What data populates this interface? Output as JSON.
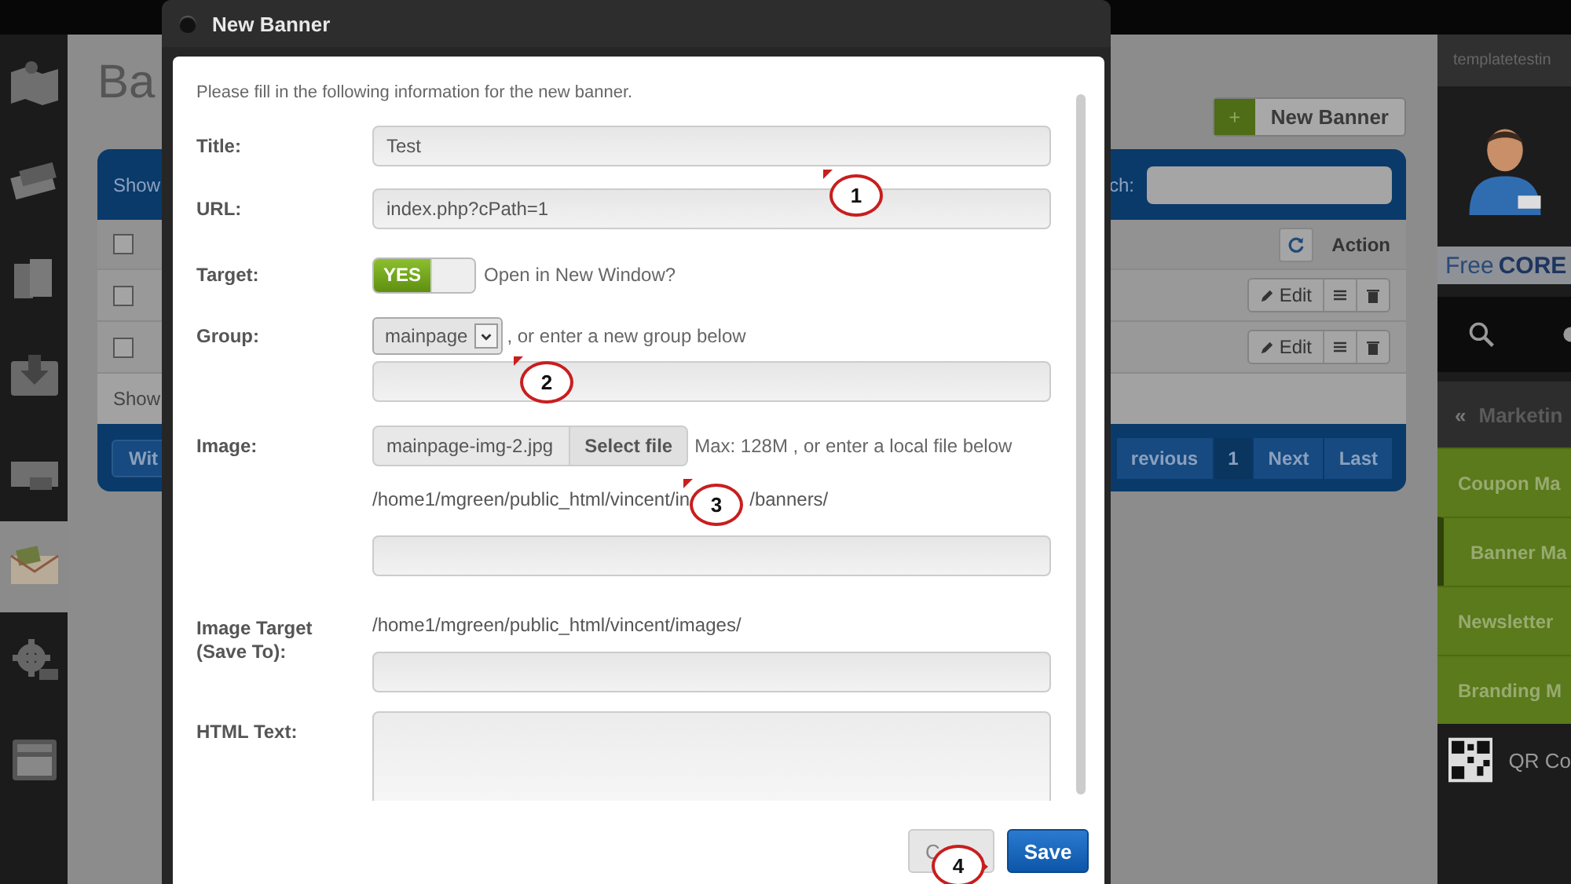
{
  "left_sidebar": {
    "items": [
      {
        "selected": false
      },
      {
        "selected": false
      },
      {
        "selected": false
      },
      {
        "selected": false
      },
      {
        "selected": false
      },
      {
        "selected": true
      },
      {
        "selected": false
      },
      {
        "selected": false
      }
    ]
  },
  "page": {
    "heading": "Ba",
    "new_button": {
      "icon": "+",
      "label": "New Banner"
    }
  },
  "table": {
    "show_label": "Show",
    "search_label": "ch:",
    "header": {
      "checked": false,
      "action_label": "Action"
    },
    "rows": [
      {
        "checked": false,
        "edit": "Edit"
      },
      {
        "checked": false,
        "edit": "Edit"
      }
    ],
    "footer_label": "Show",
    "bottom_button": "Wit",
    "pagination": [
      {
        "label": "revious",
        "selected": false
      },
      {
        "label": "1",
        "selected": true
      },
      {
        "label": "Next",
        "selected": false
      },
      {
        "label": "Last",
        "selected": false
      }
    ]
  },
  "right_sidebar": {
    "user": "templatetestin",
    "promo_plain": "Free",
    "promo_bold": "CORE",
    "menu_icon": "«",
    "menu_title": "Marketin",
    "items": [
      {
        "label": "Coupon Ma",
        "selected": false
      },
      {
        "label": "Banner Ma",
        "selected": true
      },
      {
        "label": "Newsletter",
        "selected": false
      },
      {
        "label": "Branding M",
        "selected": false
      }
    ],
    "qr_item": "QR Co"
  },
  "dialog": {
    "title": "New Banner",
    "intro": "Please fill in the following information for the new banner.",
    "title_label": "Title:",
    "title_value": "Test",
    "url_label": "URL:",
    "url_value": "index.php?cPath=1",
    "target_label": "Target:",
    "target_toggle": {
      "label": "YES",
      "on": true
    },
    "target_text": "Open in New Window?",
    "group_label": "Group:",
    "group_select": "mainpage",
    "group_hint": ", or enter a new group below",
    "image_label": "Image:",
    "image_file": "mainpage-img-2.jpg",
    "select_file": "Select file",
    "image_hint": "Max: 128M , or enter a local file below",
    "image_path_start": "/home1/mgreen/public_html/vincent/in",
    "image_path_end": "/banners/",
    "image_target_label": "Image Target (Save To):",
    "image_target_path": "/home1/mgreen/public_html/vincent/images/",
    "html_label": "HTML Text:",
    "cancel": "C",
    "save": "Save"
  },
  "callouts": [
    {
      "number": "1"
    },
    {
      "number": "2"
    },
    {
      "number": "3"
    },
    {
      "number": "4"
    }
  ]
}
